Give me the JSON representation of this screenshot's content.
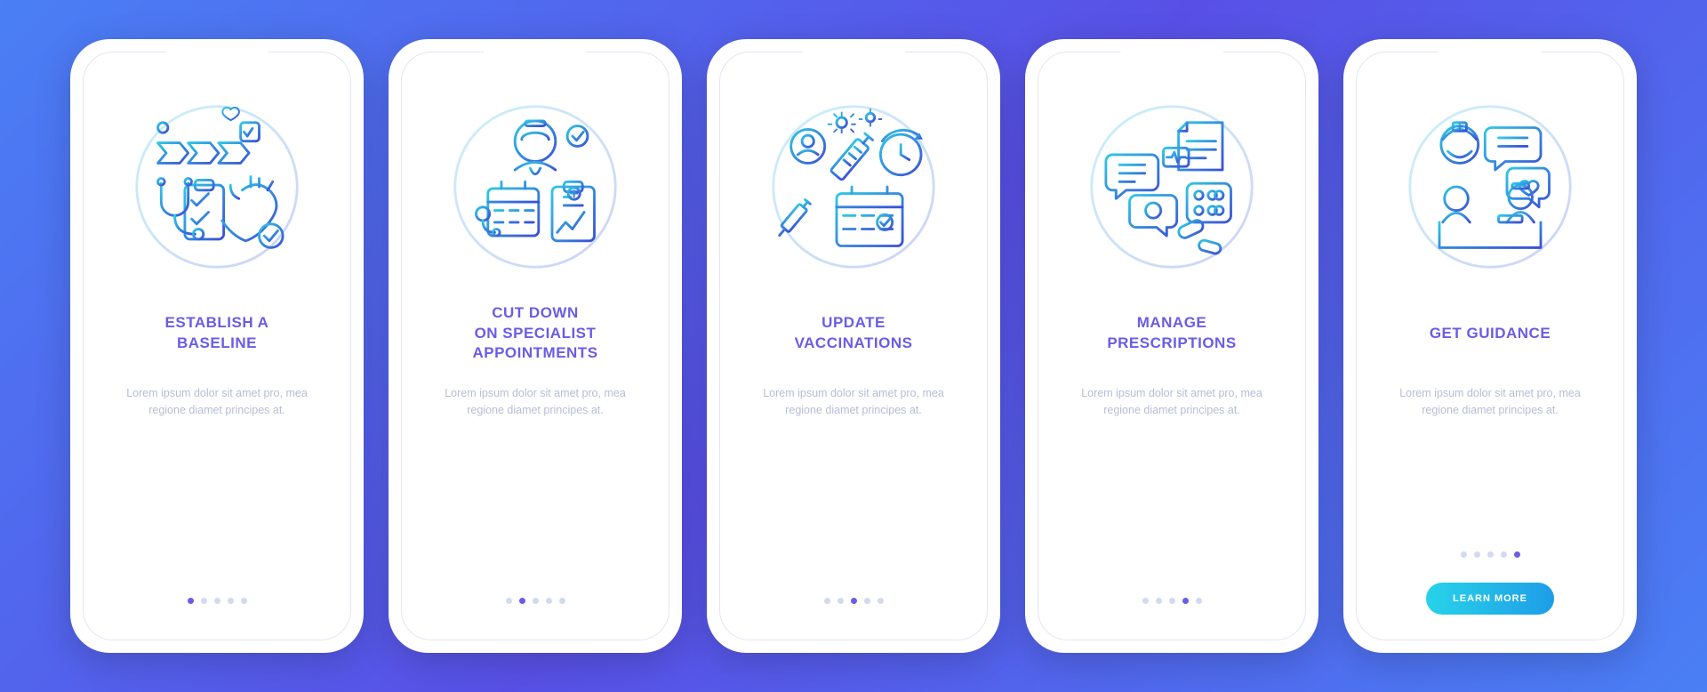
{
  "button_label": "LEARN MORE",
  "lorem": "Lorem ipsum dolor sit amet pro, mea regione diamet principes at.",
  "slides": [
    {
      "title": "ESTABLISH A\nBASELINE",
      "icon": "baseline-icon",
      "active_dot": 0,
      "has_button": false
    },
    {
      "title": "CUT DOWN\nON SPECIALIST\nAPPOINTMENTS",
      "icon": "specialist-icon",
      "active_dot": 1,
      "has_button": false
    },
    {
      "title": "UPDATE\nVACCINATIONS",
      "icon": "vaccinations-icon",
      "active_dot": 2,
      "has_button": false
    },
    {
      "title": "MANAGE\nPRESCRIPTIONS",
      "icon": "prescriptions-icon",
      "active_dot": 3,
      "has_button": false
    },
    {
      "title": "GET GUIDANCE",
      "icon": "guidance-icon",
      "active_dot": 4,
      "has_button": true
    }
  ],
  "dot_count": 5,
  "colors": {
    "accent": "#6b5ce7",
    "muted": "#b7bdd5",
    "gradient_a": "#27d3e8",
    "gradient_b": "#1e9de8"
  }
}
